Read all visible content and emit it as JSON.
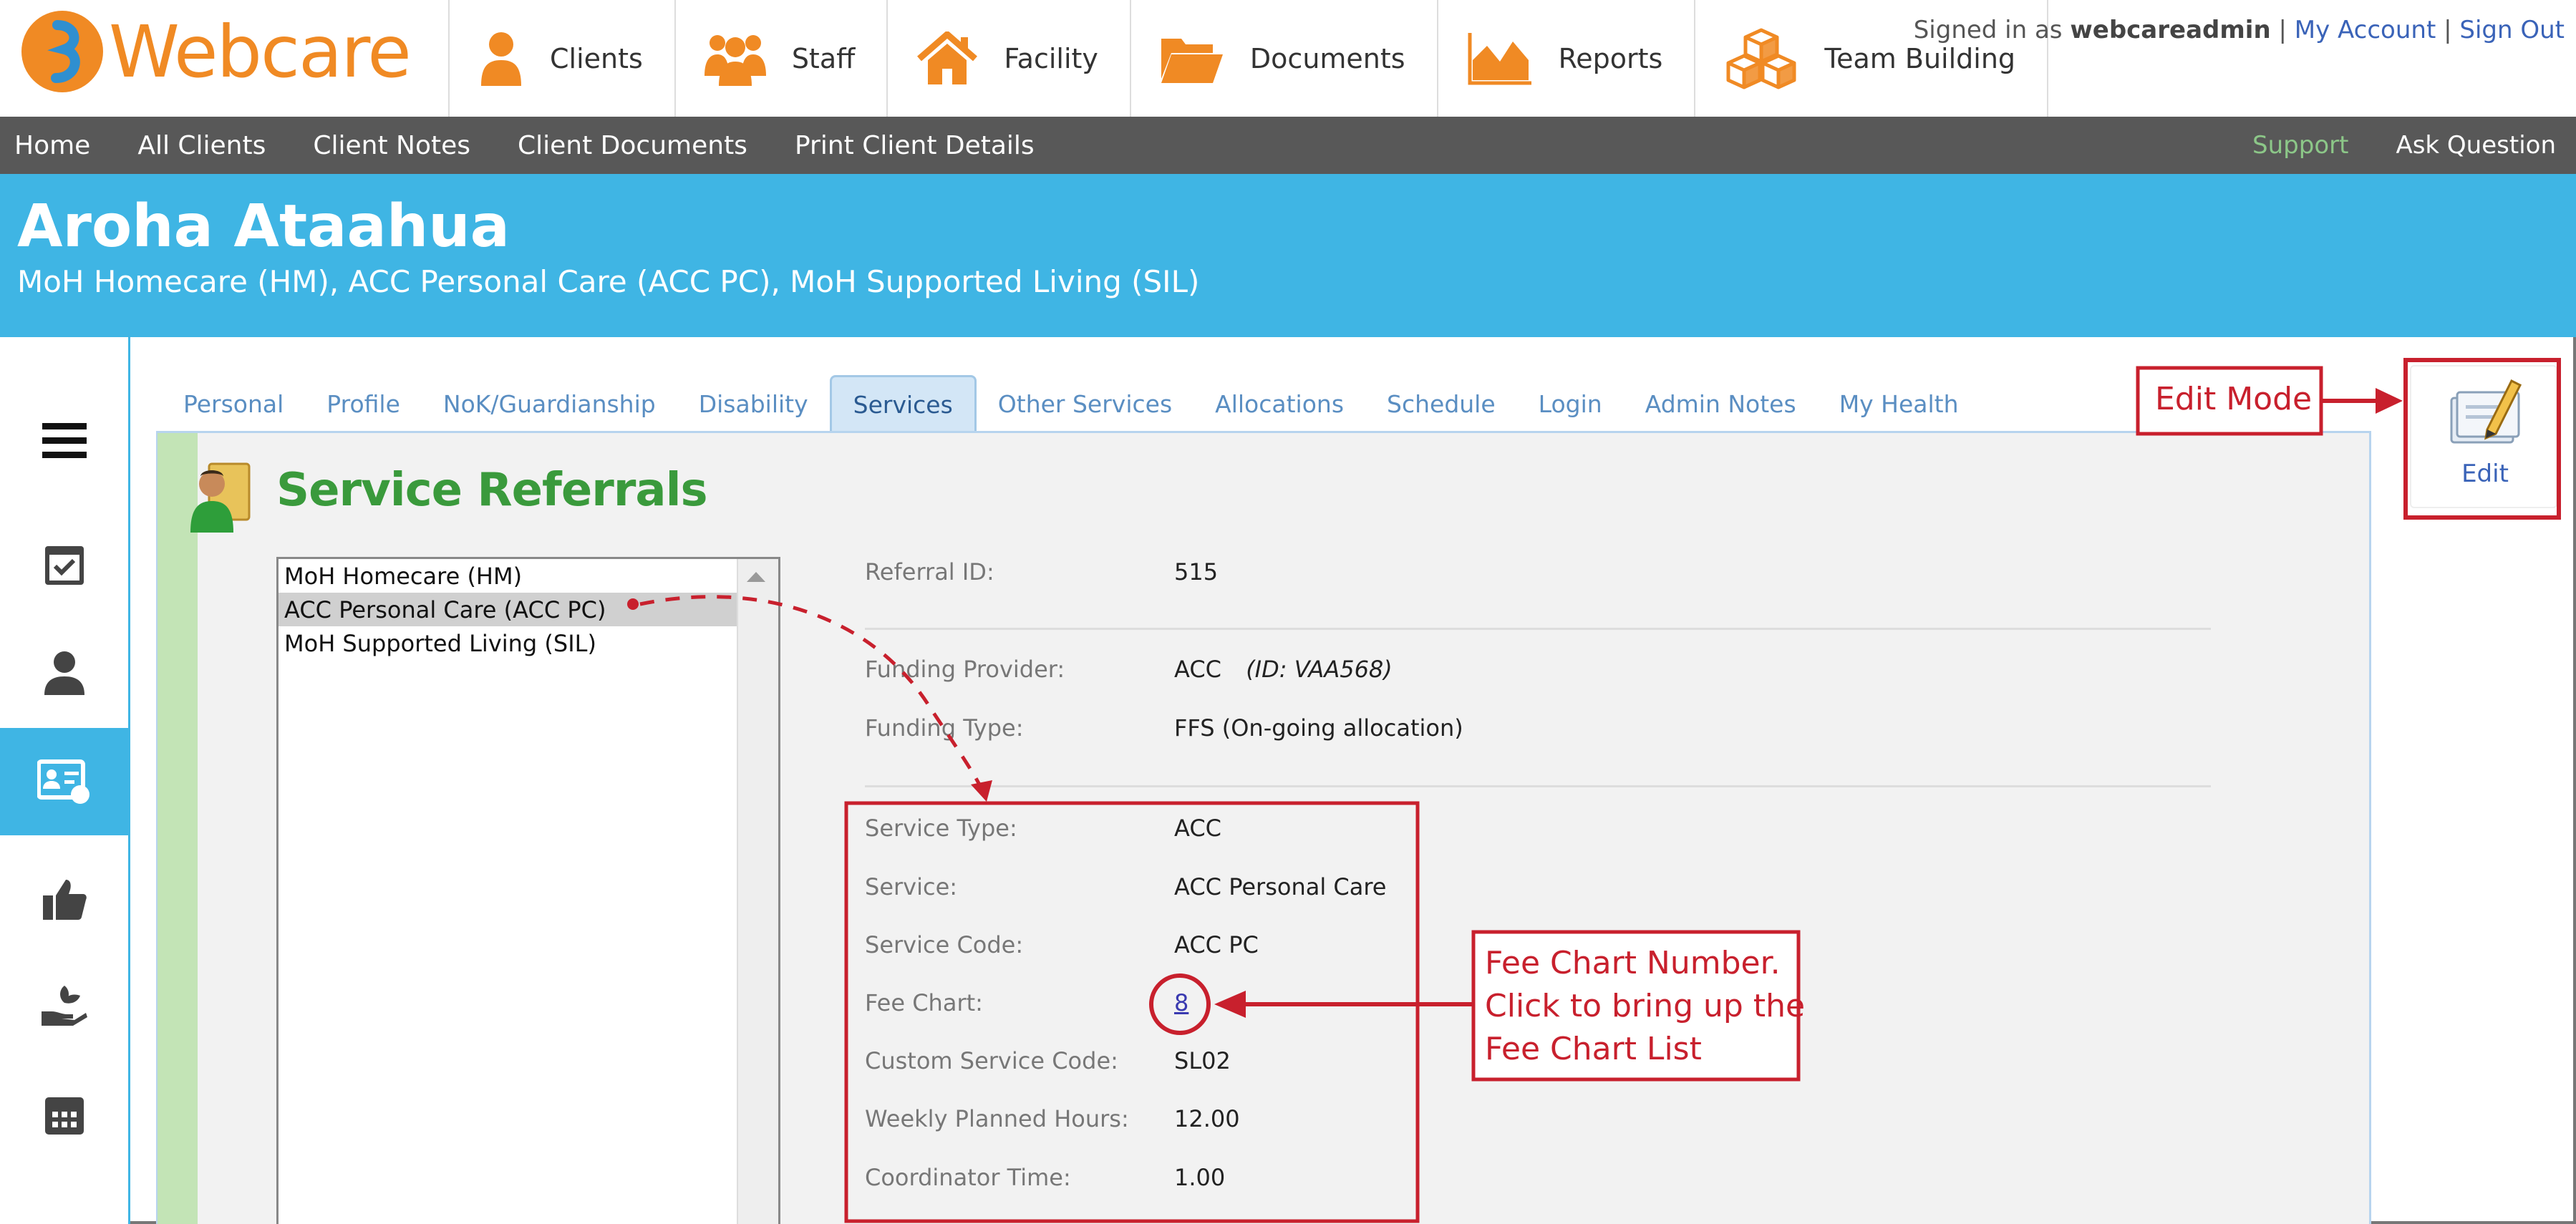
{
  "app": {
    "logo_text": "Webcare"
  },
  "main_nav": [
    {
      "label": "Clients",
      "icon": "person-icon"
    },
    {
      "label": "Staff",
      "icon": "group-icon"
    },
    {
      "label": "Facility",
      "icon": "house-icon"
    },
    {
      "label": "Documents",
      "icon": "folder-icon"
    },
    {
      "label": "Reports",
      "icon": "chart-icon"
    },
    {
      "label": "Team Building",
      "icon": "boxes-icon"
    }
  ],
  "account": {
    "signed_in_prefix": "Signed in as",
    "username": "webcareadmin",
    "separator": "|",
    "my_account": "My Account",
    "sign_out": "Sign Out"
  },
  "sub_nav": {
    "left": [
      "Home",
      "All Clients",
      "Client Notes",
      "Client Documents",
      "Print Client Details"
    ],
    "support": "Support",
    "ask_question": "Ask Question"
  },
  "client": {
    "name": "Aroha Ataahua",
    "services": "MoH Homecare (HM), ACC Personal Care (ACC PC), MoH Supported Living (SIL)"
  },
  "tabs": [
    {
      "label": "Personal",
      "active": false
    },
    {
      "label": "Profile",
      "active": false
    },
    {
      "label": "NoK/Guardianship",
      "active": false
    },
    {
      "label": "Disability",
      "active": false
    },
    {
      "label": "Services",
      "active": true
    },
    {
      "label": "Other Services",
      "active": false
    },
    {
      "label": "Allocations",
      "active": false
    },
    {
      "label": "Schedule",
      "active": false
    },
    {
      "label": "Login",
      "active": false
    },
    {
      "label": "Admin Notes",
      "active": false
    },
    {
      "label": "My Health",
      "active": false
    }
  ],
  "panel": {
    "title": "Service Referrals",
    "referral_list": [
      {
        "label": "MoH Homecare (HM)",
        "selected": false
      },
      {
        "label": "ACC Personal Care (ACC PC)",
        "selected": true
      },
      {
        "label": "MoH Supported Living (SIL)",
        "selected": false
      }
    ],
    "details": {
      "referral_id": {
        "label": "Referral ID:",
        "value": "515"
      },
      "funding_provider": {
        "label": "Funding Provider:",
        "value": "ACC",
        "id": "(ID: VAA568)"
      },
      "funding_type": {
        "label": "Funding Type:",
        "value": "FFS (On-going allocation)"
      },
      "service_type": {
        "label": "Service Type:",
        "value": "ACC"
      },
      "service": {
        "label": "Service:",
        "value": "ACC Personal Care"
      },
      "service_code": {
        "label": "Service Code:",
        "value": "ACC PC"
      },
      "fee_chart": {
        "label": "Fee Chart:",
        "value": "8"
      },
      "custom_service_code": {
        "label": "Custom Service Code:",
        "value": "SL02"
      },
      "weekly_planned_hours": {
        "label": "Weekly Planned Hours:",
        "value": "12.00"
      },
      "coordinator_time": {
        "label": "Coordinator Time:",
        "value": "1.00"
      }
    }
  },
  "edit_button": {
    "label": "Edit"
  },
  "annotations": {
    "edit_mode": "Edit Mode",
    "fee_chart_line1": "Fee Chart Number.",
    "fee_chart_line2": "Click to bring up the",
    "fee_chart_line3": "Fee Chart List"
  },
  "colors": {
    "banner": "#3fb5e4",
    "subnav": "#585858",
    "title_green": "#3a9a3c",
    "annotation_red": "#c8202d",
    "logo_orange": "#f08a24"
  }
}
